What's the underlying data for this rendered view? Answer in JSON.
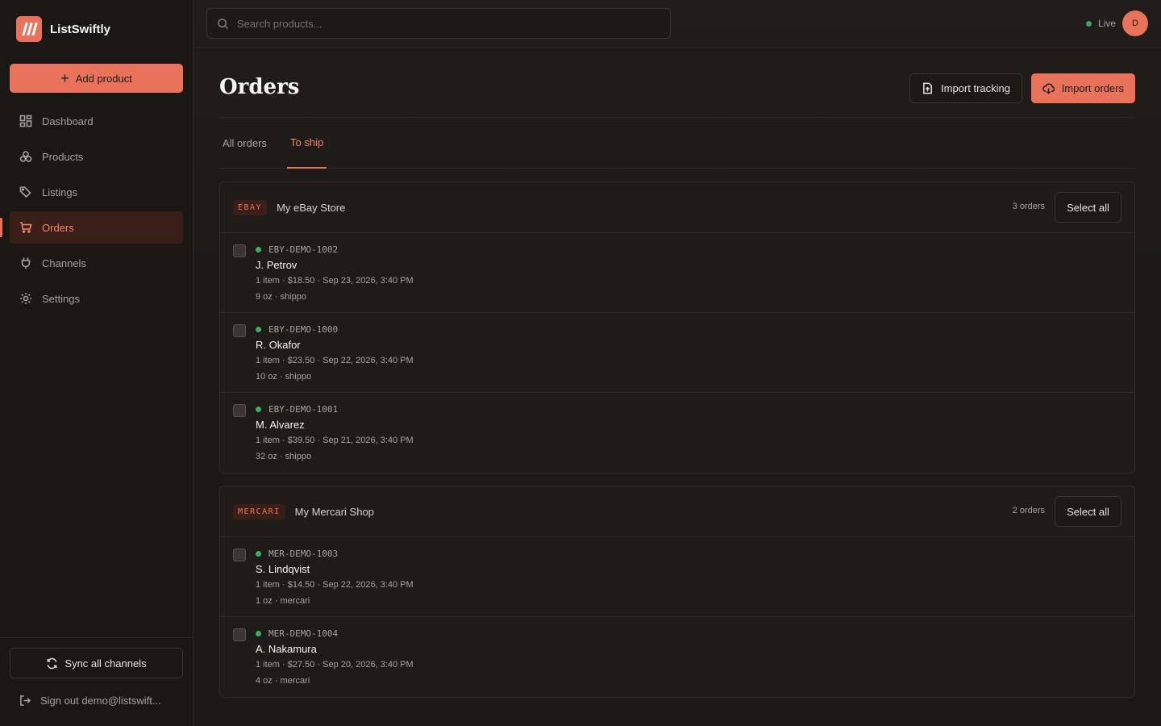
{
  "brand": {
    "name": "ListSwiftly"
  },
  "sidebar": {
    "add_label": "Add product",
    "items": [
      {
        "label": "Dashboard",
        "icon": "dashboard-icon"
      },
      {
        "label": "Products",
        "icon": "products-icon"
      },
      {
        "label": "Listings",
        "icon": "tag-icon"
      },
      {
        "label": "Orders",
        "icon": "cart-icon",
        "active": true
      },
      {
        "label": "Channels",
        "icon": "plug-icon"
      },
      {
        "label": "Settings",
        "icon": "gear-icon"
      }
    ],
    "sync_label": "Sync all channels",
    "signout_label": "Sign out demo@listswift..."
  },
  "topbar": {
    "search_placeholder": "Search products...",
    "status": "Live",
    "avatar_initial": "D"
  },
  "page": {
    "title": "Orders",
    "import_tracking_label": "Import tracking",
    "import_orders_label": "Import orders",
    "tabs": [
      {
        "label": "All orders",
        "active": false
      },
      {
        "label": "To ship",
        "active": true
      }
    ]
  },
  "groups": [
    {
      "tag": "EBAY",
      "store": "My eBay Store",
      "count": "3 orders",
      "select_all": "Select all",
      "orders": [
        {
          "id": "EBY-DEMO-1002",
          "buyer": "J. Petrov",
          "meta": "1 item · $18.50 · Sep 23, 2026, 3:40 PM",
          "meta2": "9 oz · shippo"
        },
        {
          "id": "EBY-DEMO-1000",
          "buyer": "R. Okafor",
          "meta": "1 item · $23.50 · Sep 22, 2026, 3:40 PM",
          "meta2": "10 oz · shippo"
        },
        {
          "id": "EBY-DEMO-1001",
          "buyer": "M. Alvarez",
          "meta": "1 item · $39.50 · Sep 21, 2026, 3:40 PM",
          "meta2": "32 oz · shippo"
        }
      ]
    },
    {
      "tag": "MERCARI",
      "store": "My Mercari Shop",
      "count": "2 orders",
      "select_all": "Select all",
      "orders": [
        {
          "id": "MER-DEMO-1003",
          "buyer": "S. Lindqvist",
          "meta": "1 item · $14.50 · Sep 22, 2026, 3:40 PM",
          "meta2": "1 oz · mercari"
        },
        {
          "id": "MER-DEMO-1004",
          "buyer": "A. Nakamura",
          "meta": "1 item · $27.50 · Sep 20, 2026, 3:40 PM",
          "meta2": "4 oz · mercari"
        }
      ]
    }
  ],
  "colors": {
    "accent": "#e8735a",
    "status_dot": "#4ade80",
    "background": "#1c1917"
  }
}
